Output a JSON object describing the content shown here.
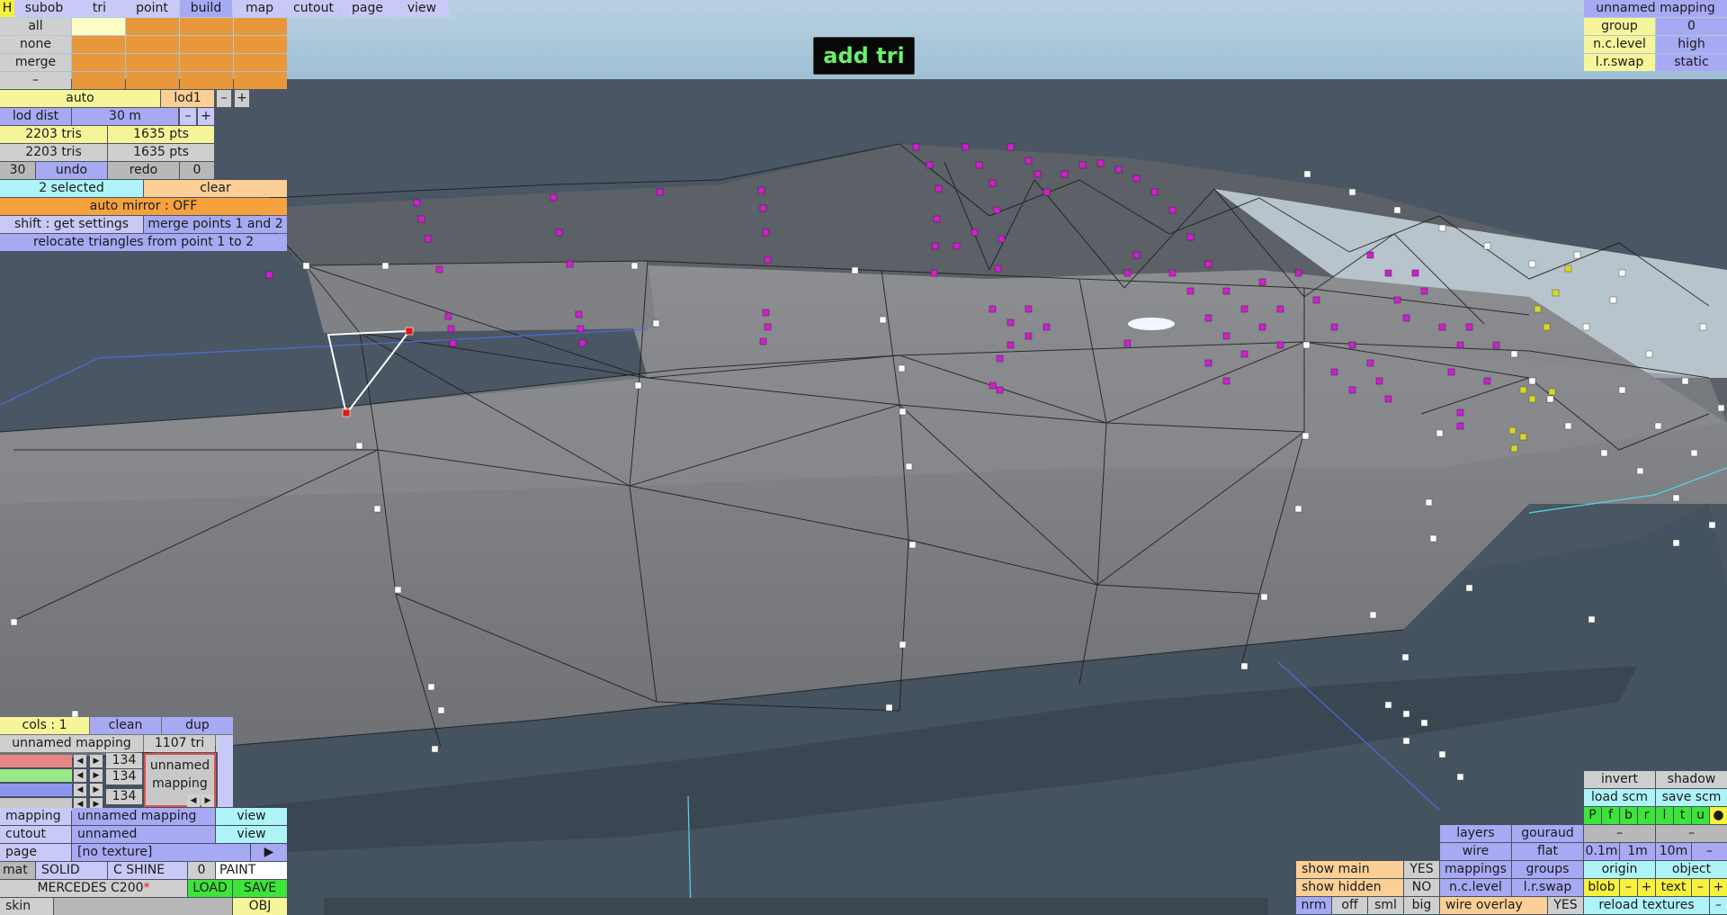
{
  "mode_badge": "add tri",
  "top_tabs": [
    "H",
    "subob",
    "tri",
    "point",
    "build",
    "map",
    "cutout",
    "page",
    "view"
  ],
  "selection_rows": [
    "all",
    "none",
    "merge",
    "–"
  ],
  "lod": {
    "auto": "auto",
    "level": "lod1",
    "minus": "–",
    "plus": "+",
    "dist_label": "lod dist",
    "dist_value": "30 m"
  },
  "stats": {
    "row1_tris": "2203 tris",
    "row1_pts": "1635 pts",
    "row2_tris": "2203 tris",
    "row2_pts": "1635 pts"
  },
  "undo_row": {
    "count": "30",
    "undo": "undo",
    "redo": "redo",
    "redo_count": "0"
  },
  "selection": {
    "count": "2 selected",
    "clear": "clear"
  },
  "auto_mirror": "auto mirror : OFF",
  "hints": {
    "shift": "shift : get settings",
    "merge": "merge points 1 and 2",
    "relocate": "relocate triangles from point 1 to 2"
  },
  "mapping_panel": {
    "title": "unnamed mapping",
    "group_label": "group",
    "group_value": "0",
    "nclevel_label": "n.c.level",
    "nclevel_value": "high",
    "lrswap_label": "l.r.swap",
    "lrswap_value": "static"
  },
  "cols_row": {
    "cols": "cols : 1",
    "clean": "clean",
    "dup": "dup"
  },
  "map_info": {
    "name": "unnamed mapping",
    "tris": "1107 tri"
  },
  "channels": [
    "134",
    "134",
    "134"
  ],
  "preview_label": "unnamed mapping",
  "bottom_left": {
    "mapping_label": "mapping",
    "mapping_value": "unnamed mapping",
    "mapping_view": "view",
    "cutout_label": "cutout",
    "cutout_value": "unnamed",
    "cutout_view": "view",
    "page_label": "page",
    "page_value": "[no texture]",
    "page_arrow": "▶",
    "mat_label": "mat",
    "solid": "SOLID",
    "shine": "C SHINE",
    "zero": "0",
    "paint": "PAINT",
    "model_name": "MERCEDES C200",
    "modified_mark": "*",
    "load": "LOAD",
    "save": "SAVE",
    "skin": "skin",
    "obj": "OBJ"
  },
  "bottom_right": {
    "invert": "invert",
    "shadow": "shadow",
    "load_scm": "load scm",
    "save_scm": "save scm",
    "views": [
      "P",
      "f",
      "b",
      "r",
      "l",
      "t",
      "u",
      "●"
    ],
    "dash1": "–",
    "dash2": "–",
    "layers": "layers",
    "gouraud": "gouraud",
    "wire": "wire",
    "flat": "flat",
    "grid_01": "0.1m",
    "grid_1": "1m",
    "grid_10": "10m",
    "grid_minus": "–",
    "mappings": "mappings",
    "groups": "groups",
    "origin": "origin",
    "object": "object",
    "nclevel": "n.c.level",
    "lrswap": "l.r.swap",
    "blob": "blob",
    "blob_minus": "–",
    "blob_plus": "+",
    "text": "text",
    "text_minus": "–",
    "text_plus": "+",
    "show_main": "show main",
    "show_main_val": "YES",
    "show_hidden": "show hidden",
    "show_hidden_val": "NO",
    "nrm": "nrm",
    "off": "off",
    "sml": "sml",
    "big": "big",
    "wire_overlay": "wire overlay",
    "wire_overlay_val": "YES",
    "reload": "reload textures",
    "reload_minus": "–"
  },
  "colors": {
    "background": "#4a5663",
    "mesh": "#8b8d90",
    "selected_point": "#e01818",
    "magenta_point": "#cc22cc",
    "yellow_point": "#d8d820",
    "panel_yellow": "#f7f59a",
    "panel_orange": "#e9973b",
    "panel_purple": "#a8a9f3"
  }
}
